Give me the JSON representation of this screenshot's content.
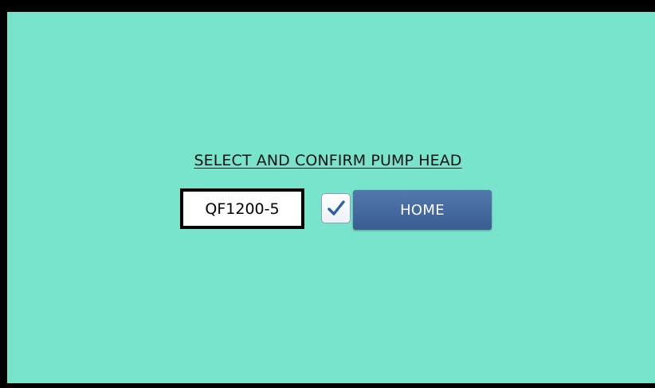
{
  "screen": {
    "title": "SELECT AND CONFIRM PUMP HEAD",
    "pump_head_value": "QF1200-5",
    "confirm_checked": true,
    "home_label": "HOME"
  },
  "colors": {
    "background": "#77e4cb",
    "button": "#446a9f",
    "check": "#2f5fa8"
  }
}
